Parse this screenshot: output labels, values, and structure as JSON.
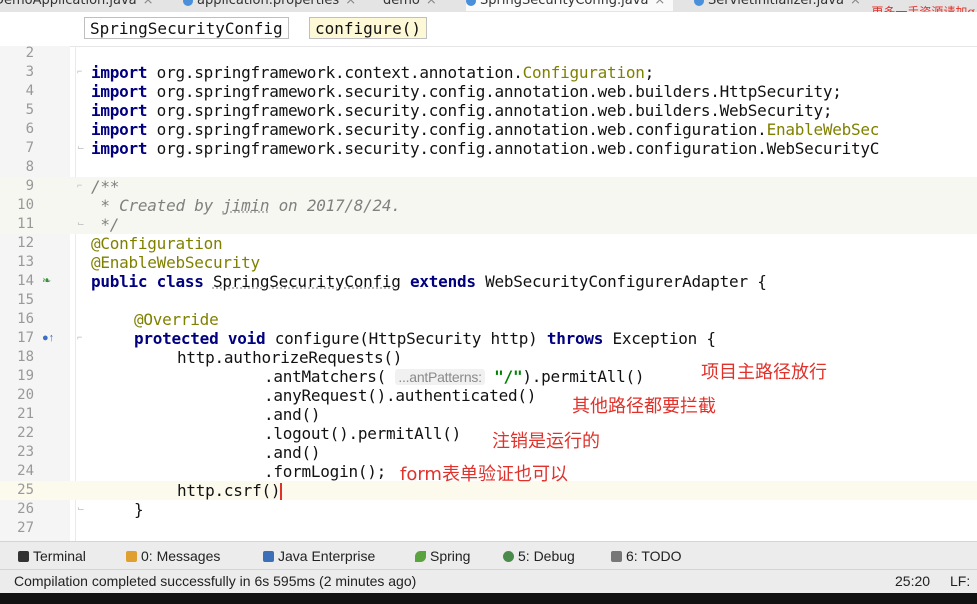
{
  "tabs": [
    {
      "label": "DemoApplication.java",
      "close": "×"
    },
    {
      "label": "application.properties",
      "close": "×"
    },
    {
      "label": "demo",
      "close": "×"
    },
    {
      "label": "SpringSecurityConfig.java",
      "close": "×"
    },
    {
      "label": "ServletInitializer.java",
      "close": "×"
    }
  ],
  "watermark": "更多一手资源请加q",
  "breadcrumb": {
    "class_name": "SpringSecurityConfig",
    "method_name": "configure()"
  },
  "lines": {
    "n2": "2",
    "n3": "3",
    "n4": "4",
    "n5": "5",
    "n6": "6",
    "n7": "7",
    "n8": "8",
    "n9": "9",
    "n10": "10",
    "n11": "11",
    "n12": "12",
    "n13": "13",
    "n14": "14",
    "n15": "15",
    "n16": "16",
    "n17": "17",
    "n18": "18",
    "n19": "19",
    "n20": "20",
    "n21": "21",
    "n22": "22",
    "n23": "23",
    "n24": "24",
    "n25": "25",
    "n26": "26",
    "n27": "27"
  },
  "code": {
    "import_kw": "import",
    "l3": " org.springframework.context.annotation.",
    "l3_cls": "Configuration",
    "l3_end": ";",
    "l4": " org.springframework.security.config.annotation.web.builders.HttpSecurity;",
    "l5": " org.springframework.security.config.annotation.web.builders.WebSecurity;",
    "l6": " org.springframework.security.config.annotation.web.configuration.",
    "l6_cls": "EnableWebSec",
    "l7": " org.springframework.security.config.annotation.web.configuration.WebSecurityC",
    "l9": "/**",
    "l10_a": " * Created by ",
    "l10_b": "jimin",
    "l10_c": " on 2017/8/24.",
    "l11": " */",
    "l12": "@Configuration",
    "l13": "@EnableWebSecurity",
    "l14_kw1": "public class",
    "l14_cls": "SpringSecurityConfig",
    "l14_kw2": "extends",
    "l14_rest": " WebSecurityConfigurerAdapter {",
    "l16": "@Override",
    "l17_kw": "protected void",
    "l17_mid": " configure(HttpSecurity http) ",
    "l17_kw2": "throws",
    "l17_end": " Exception {",
    "l18": "http.authorizeRequests()",
    "l19_a": ".antMatchers( ",
    "l19_hint": "...antPatterns:",
    "l19_str": "\"/\"",
    "l19_b": ").permitAll()",
    "l20": ".anyRequest().authenticated()",
    "l21": ".and()",
    "l22": ".logout().permitAll()",
    "l23": ".and()",
    "l24": ".formLogin();",
    "l25": "http.csrf()",
    "l26": "}"
  },
  "notes": {
    "n19": "项目主路径放行",
    "n20": "其他路径都要拦截",
    "n22": "注销是运行的",
    "n24": "form表单验证也可以"
  },
  "toolwindows": {
    "terminal": "Terminal",
    "messages": "0: Messages",
    "java_enterprise": "Java Enterprise",
    "spring": "Spring",
    "debug": "5: Debug",
    "todo": "6: TODO"
  },
  "status": {
    "message": "Compilation completed successfully in 6s 595ms (2 minutes ago)",
    "position": "25:20",
    "line_sep": "LF:"
  },
  "colors": {
    "keyword": "#000080",
    "annotation": "#808000",
    "comment": "#808080",
    "note": "#e0322b"
  }
}
